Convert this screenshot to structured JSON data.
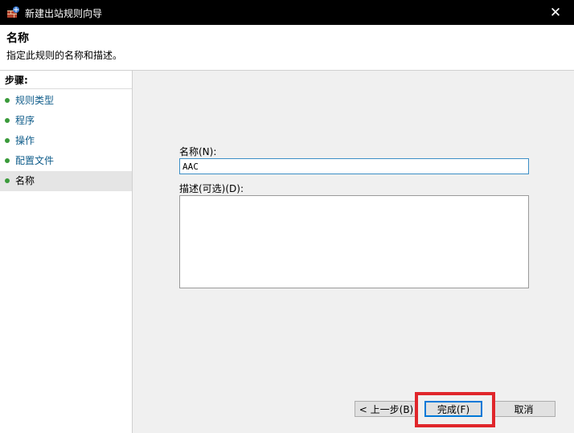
{
  "window": {
    "title": "新建出站规则向导",
    "close_symbol": "✕"
  },
  "header": {
    "title": "名称",
    "description": "指定此规则的名称和描述。"
  },
  "steps": {
    "title": "步骤:",
    "items": [
      {
        "label": "规则类型"
      },
      {
        "label": "程序"
      },
      {
        "label": "操作"
      },
      {
        "label": "配置文件"
      },
      {
        "label": "名称"
      }
    ],
    "current_index": 4
  },
  "form": {
    "name_label": "名称(N):",
    "name_value": "AAC",
    "desc_label": "描述(可选)(D):",
    "desc_value": ""
  },
  "buttons": {
    "back": "< 上一步(B)",
    "finish": "完成(F)",
    "cancel": "取消"
  },
  "colors": {
    "link": "#0f5c8a",
    "step_dot": "#3a9a3a",
    "focus_border": "#3c8fc6",
    "highlight": "#e0262b"
  }
}
